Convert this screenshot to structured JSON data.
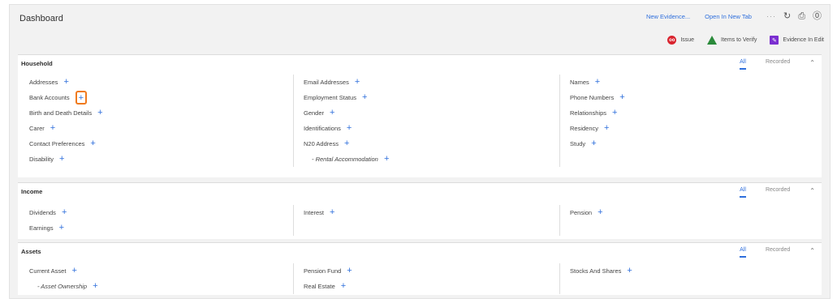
{
  "header": {
    "title": "Dashboard",
    "links": [
      "New Evidence...",
      "Open In New Tab"
    ],
    "icons": [
      "more-icon",
      "refresh-icon",
      "print-icon",
      "help-icon"
    ]
  },
  "legend": {
    "issue": "Issue",
    "verify": "Items to Verify",
    "edit": "Evidence In Edit",
    "issue_badge": "oo"
  },
  "sections": [
    {
      "title": "Household",
      "tabs": [
        "All",
        "Recorded"
      ],
      "columns": [
        [
          "Addresses",
          "Bank Accounts",
          "Birth and Death Details",
          "Carer",
          "Contact Preferences",
          "Disability"
        ],
        [
          "Email Addresses",
          "Employment Status",
          "Gender",
          "Identifications",
          "N20 Address",
          "- Rental Accommodation"
        ],
        [
          "Names",
          "Phone Numbers",
          "Relationships",
          "Residency",
          "Study"
        ]
      ]
    },
    {
      "title": "Income",
      "tabs": [
        "All",
        "Recorded"
      ],
      "columns": [
        [
          "Dividends",
          "Earnings"
        ],
        [
          "Interest"
        ],
        [
          "Pension"
        ]
      ]
    },
    {
      "title": "Assets",
      "tabs": [
        "All",
        "Recorded"
      ],
      "columns": [
        [
          "Current Asset",
          "- Asset Ownership"
        ],
        [
          "Pension Fund",
          "Real Estate"
        ],
        [
          "Stocks And Shares"
        ]
      ]
    }
  ],
  "colors": {
    "accent": "#2f6fdc",
    "highlight": "#f07a1e",
    "issue": "#d9232e",
    "verify": "#2a8a3a",
    "edit": "#7b2fd0"
  }
}
